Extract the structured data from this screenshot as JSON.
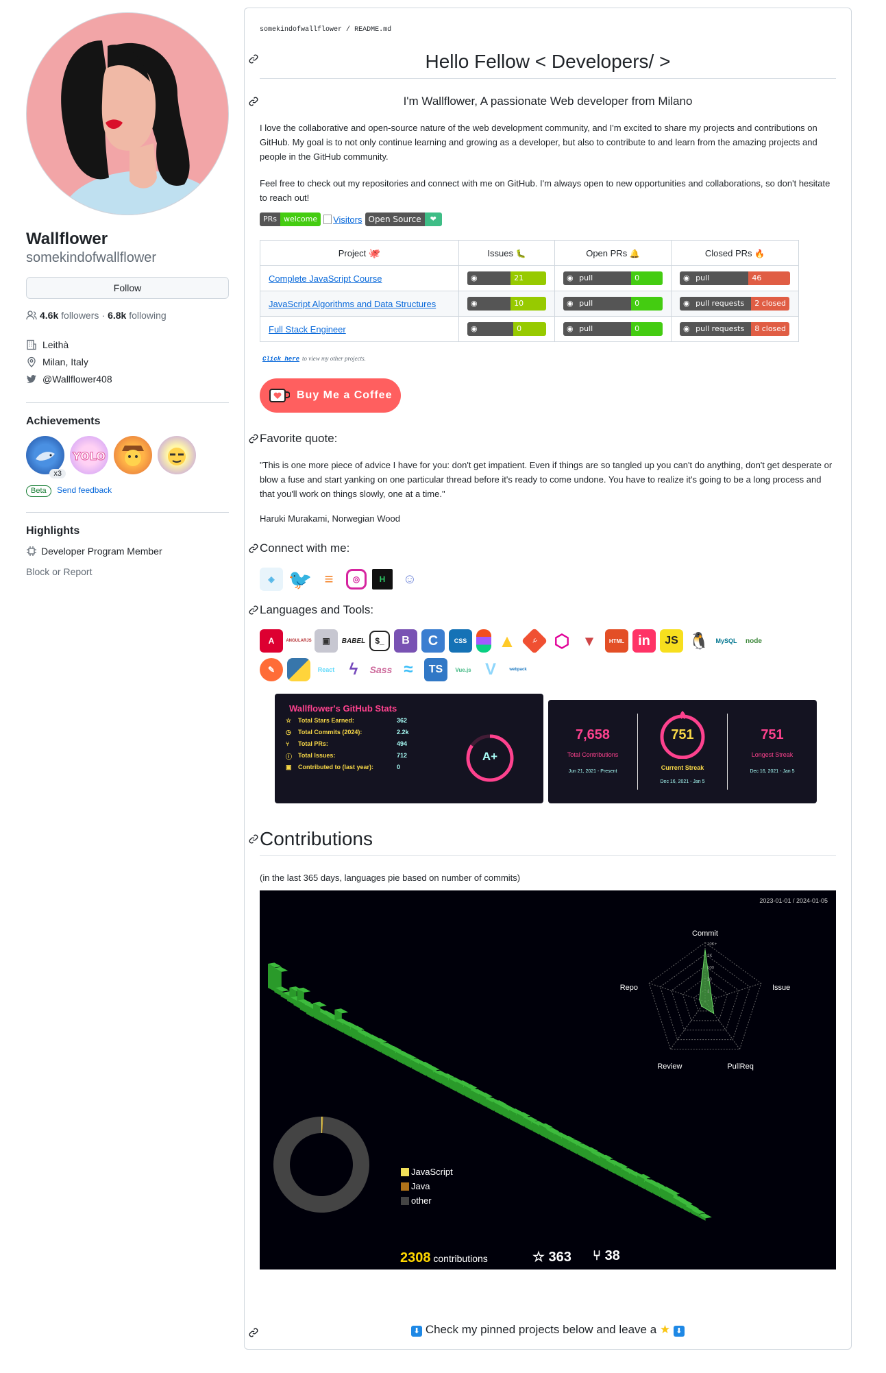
{
  "profile": {
    "name": "Wallflower",
    "login": "somekindofwallflower",
    "follow_label": "Follow",
    "followers_count": "4.6k",
    "followers_label": "followers",
    "separator": "·",
    "following_count": "6.8k",
    "following_label": "following",
    "company": "Leithà",
    "location": "Milan, Italy",
    "twitter": "@Wallflower408"
  },
  "achievements": {
    "title": "Achievements",
    "multiplier": "x3",
    "beta_label": "Beta",
    "feedback_label": "Send feedback"
  },
  "highlights": {
    "title": "Highlights",
    "item": "Developer Program Member",
    "block_report": "Block or Report"
  },
  "readme": {
    "breadcrumb_user": "somekindofwallflower",
    "breadcrumb_sep": "/",
    "breadcrumb_file": "README.md",
    "heading": "Hello Fellow < Developers/ >",
    "intro": "I'm Wallflower, A passionate Web developer from Milano",
    "paragraph1": "I love the collaborative and open-source nature of the web development community, and I'm excited to share my projects and contributions on GitHub. My goal is to not only continue learning and growing as a developer, but also to contribute to and learn from the amazing projects and people in the GitHub community.",
    "paragraph2": "Feel free to check out my repositories and connect with me on GitHub. I'm always open to new opportunities and collaborations, so don't hesitate to reach out!",
    "badge_prs": "PRs",
    "badge_welcome": "welcome",
    "badge_visitors": "Visitors",
    "badge_open_source": "Open Source"
  },
  "projects": {
    "headers": [
      "Project",
      "Issues",
      "Open PRs",
      "Closed PRs"
    ],
    "rows": [
      {
        "name": "Complete JavaScript Course",
        "issues_label": "issues",
        "issues": "21 open",
        "pr_label": "pull requests",
        "open_prs": "0 open",
        "closed_prs": "46 closed"
      },
      {
        "name": "JavaScript Algorithms and Data Structures",
        "issues_label": "issues",
        "issues": "10 open",
        "pr_label": "pull requests",
        "open_prs": "0 open",
        "closed_prs": "2 closed"
      },
      {
        "name": "Full Stack Engineer",
        "issues_label": "issues",
        "issues": "0 open",
        "pr_label": "pull requests",
        "open_prs": "0 open",
        "closed_prs": "8 closed"
      }
    ],
    "click_here": "Click here",
    "click_suffix": "to view my other projects."
  },
  "coffee": {
    "label": "Buy Me a Coffee"
  },
  "quote": {
    "title": "Favorite quote:",
    "text": "\"This is one more piece of advice I have for you: don't get impatient. Even if things are so tangled up you can't do anything, don't get desperate or blow a fuse and start yanking on one particular thread before it's ready to come undone. You have to realize it's going to be a long process and that you'll work on things slowly, one at a time.\"",
    "author": "Haruki Murakami, Norwegian Wood"
  },
  "connect": {
    "title": "Connect with me:"
  },
  "tools": {
    "title": "Languages and Tools:",
    "items_row1": [
      "angular",
      "angularjs",
      "appwrite",
      "babel",
      "bash",
      "bootstrap",
      "c",
      "css3",
      "figma",
      "firebase",
      "git",
      "graphql",
      "gulp",
      "html5",
      "invision",
      "javascript",
      "linux",
      "mysql",
      "nodejs"
    ],
    "items_row2": [
      "postman",
      "python",
      "react",
      "redux",
      "sass",
      "tailwind",
      "typescript",
      "vuejs",
      "webpack"
    ],
    "labels": {
      "angularjs": "ANGULARJS",
      "babel": "BABEL",
      "bootstrap": "Bootstrap",
      "css3": "CSS",
      "html5": "HTML",
      "invision": "in",
      "javascript": "JS",
      "mysql": "MySQL",
      "nodejs": "node",
      "react": "React",
      "sass": "Sass",
      "typescript": "TS",
      "vuejs": "Vue.js",
      "webpack": "webpack"
    }
  },
  "stats": {
    "title": "Wallflower's GitHub Stats",
    "rows": [
      {
        "label": "Total Stars Earned:",
        "value": "362"
      },
      {
        "label": "Total Commits (2024):",
        "value": "2.2k"
      },
      {
        "label": "Total PRs:",
        "value": "494"
      },
      {
        "label": "Total Issues:",
        "value": "712"
      },
      {
        "label": "Contributed to (last year):",
        "value": "0"
      }
    ],
    "grade": "A+",
    "colors": {
      "title": "#fe428e",
      "label": "#f8d847",
      "value": "#a9fef7",
      "bg": "#141321"
    }
  },
  "streak": {
    "total_value": "7,658",
    "total_label": "Total Contributions",
    "total_range": "Jun 21, 2021 - Present",
    "current_value": "751",
    "current_label": "Current Streak",
    "current_range": "Dec 16, 2021 - Jan 5",
    "longest_value": "751",
    "longest_label": "Longest Streak",
    "longest_range": "Dec 16, 2021 - Jan 5"
  },
  "contributions": {
    "title": "Contributions",
    "subtitle": "(in the last 365 days, languages pie based on number of commits)",
    "period": "2023-01-01 / 2024-01-05",
    "radar": {
      "axes": [
        "Commit",
        "Issue",
        "PullReq",
        "Review",
        "Repo"
      ],
      "scale": [
        "10K+",
        "1K",
        "100",
        "10",
        "1"
      ],
      "values": [
        0.88,
        0.12,
        0.25,
        0.1,
        0.1
      ]
    },
    "languages": [
      {
        "name": "JavaScript",
        "color": "#f1e05a",
        "share": 0.004
      },
      {
        "name": "Java",
        "color": "#b07219",
        "share": 0.002
      },
      {
        "name": "other",
        "color": "#444444",
        "share": 0.994
      }
    ],
    "total": "2308",
    "total_label": "contributions",
    "stars": "363",
    "forks": "38"
  },
  "pinned": {
    "text": "Check my pinned projects below and leave a"
  }
}
